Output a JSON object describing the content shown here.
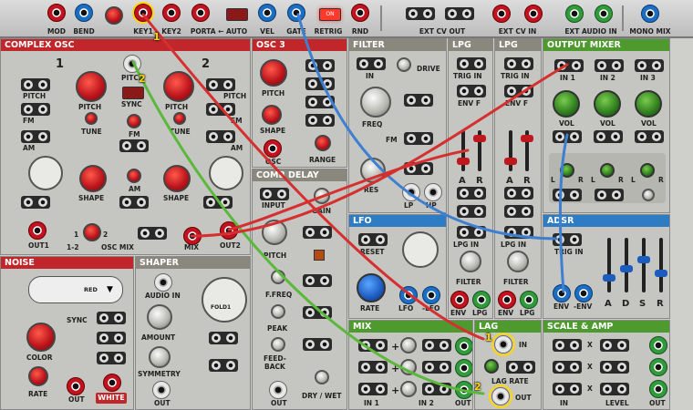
{
  "topbar": {
    "items": [
      {
        "label": "MOD",
        "color": "red"
      },
      {
        "label": "BEND",
        "color": "blue"
      },
      {
        "label": "KEY1",
        "color": "red"
      },
      {
        "label": "KEY2",
        "color": "red"
      },
      {
        "label": "PORTA ← AUTO",
        "color": "red"
      },
      {
        "label": "VEL",
        "color": "blue"
      },
      {
        "label": "GATE",
        "color": "blue"
      },
      {
        "label": "RETRIG",
        "color": "red"
      },
      {
        "label": "RND",
        "color": "red"
      }
    ],
    "ext_cv_out": "EXT CV OUT",
    "ext_cv_in": "EXT CV IN",
    "ext_audio_in": "EXT AUDIO IN",
    "mono_mix": "MONO MIX",
    "retrig_led": "ON"
  },
  "panels": {
    "complex_osc": {
      "title": "COMPLEX OSC",
      "osc1": "1",
      "osc2": "2",
      "pitch": "PITCH",
      "fm": "FM",
      "am": "AM",
      "tune": "TUNE",
      "shape": "SHAPE",
      "sync": "SYNC",
      "out1": "OUT1",
      "out2": "OUT2",
      "one_two": "1-2",
      "osc_mix": "OSC MIX",
      "mix": "MIX",
      "mix_1": "1",
      "mix_2": "2"
    },
    "osc3": {
      "title": "OSC 3",
      "pitch": "PITCH",
      "shape": "SHAPE",
      "osc": "OSC",
      "range": "RANGE"
    },
    "comb_delay": {
      "title": "COMB DELAY",
      "input": "INPUT",
      "gain": "GAIN",
      "pitch": "PITCH",
      "ffreq": "F.FREQ",
      "peak": "PEAK",
      "feedback": "FEED-\nBACK",
      "out": "OUT",
      "dry_wet": "DRY / WET"
    },
    "filter": {
      "title": "FILTER",
      "in": "IN",
      "drive": "DRIVE",
      "freq": "FREQ",
      "res": "RES",
      "lp": "LP",
      "hp": "HP",
      "fm": "FM"
    },
    "lpg1": {
      "title": "LPG",
      "trig_in": "TRIG IN",
      "env_f": "ENV F",
      "a": "A",
      "r": "R",
      "lpg_in": "LPG IN",
      "filter": "FILTER",
      "env": "ENV",
      "lpg": "LPG"
    },
    "lpg2": {
      "title": "LPG",
      "trig_in": "TRIG IN",
      "env_f": "ENV F",
      "a": "A",
      "r": "R",
      "lpg_in": "LPG IN",
      "filter": "FILTER",
      "env": "ENV",
      "lpg": "LPG"
    },
    "lfo": {
      "title": "LFO",
      "reset": "RESET",
      "rate": "RATE",
      "lfo": "LFO",
      "neg_lfo": "-LFO"
    },
    "output_mixer": {
      "title": "OUTPUT MIXER",
      "in1": "IN 1",
      "in2": "IN 2",
      "in3": "IN 3",
      "vol": "VOL",
      "l": "L",
      "r": "R"
    },
    "adsr": {
      "title": "ADSR",
      "trig_in": "TRIG IN",
      "env": "ENV",
      "neg_env": "-ENV",
      "a": "A",
      "d": "D",
      "s": "S",
      "r": "R"
    },
    "noise": {
      "title": "NOISE",
      "type": "RED",
      "sync": "SYNC",
      "color": "COLOR",
      "rate": "RATE",
      "out": "OUT",
      "white": "WHITE"
    },
    "shaper": {
      "title": "SHAPER",
      "audio_in": "AUDIO IN",
      "fold": "FOLD1",
      "amount": "AMOUNT",
      "symmetry": "SYMMETRY",
      "out": "OUT"
    },
    "mix": {
      "title": "MIX",
      "in1": "IN 1",
      "in2": "IN 2",
      "out": "OUT",
      "plus": "+"
    },
    "lag": {
      "title": "LAG",
      "in": "IN",
      "lag_rate": "LAG RATE",
      "out": "OUT"
    },
    "scale_amp": {
      "title": "SCALE & AMP",
      "in": "IN",
      "level": "LEVEL",
      "out": "OUT",
      "x": "X"
    }
  },
  "annotations": {
    "one": "1",
    "two": "2"
  },
  "cable_colors": {
    "red": "#d62f2f",
    "blue": "#3d7fd0",
    "green": "#5bb83c",
    "highlight": "#ffd60a"
  }
}
